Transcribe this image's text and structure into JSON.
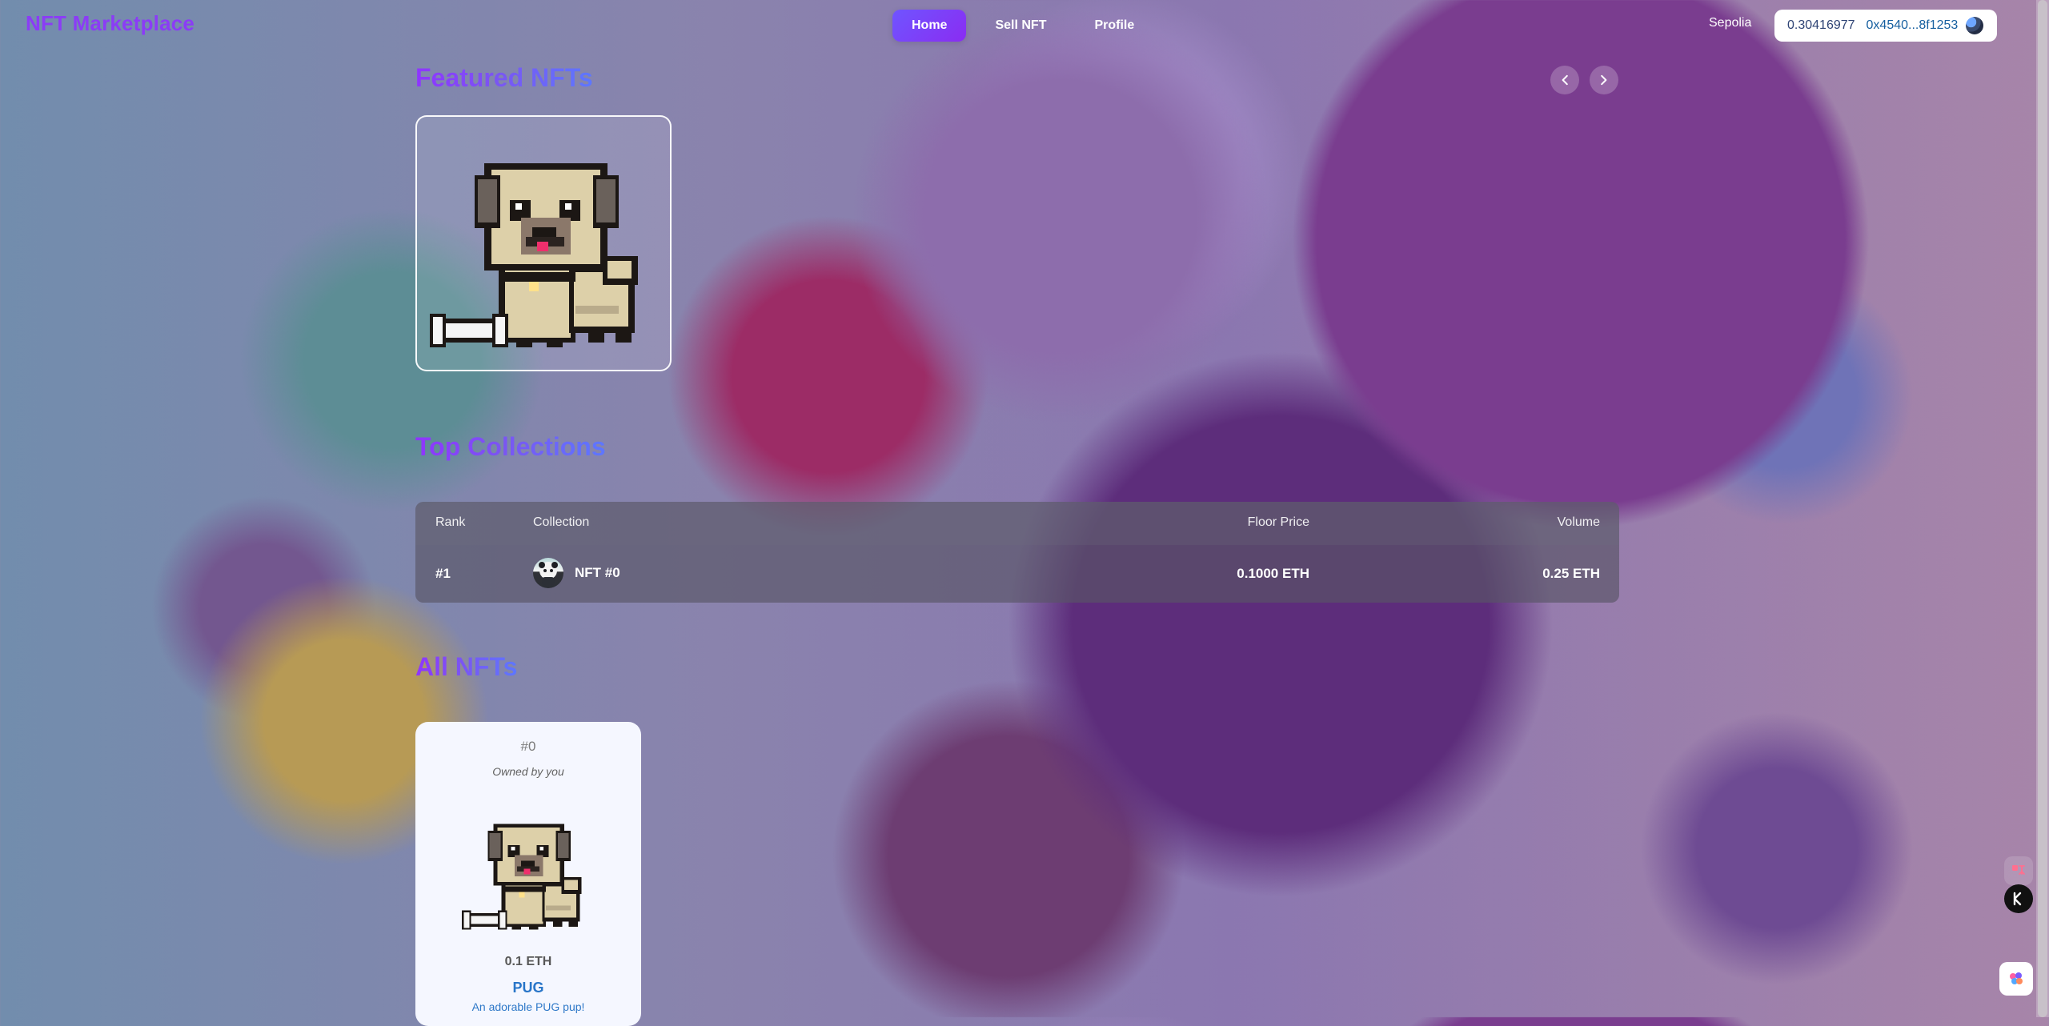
{
  "app": {
    "brand": "NFT Marketplace",
    "nav": [
      {
        "label": "Home",
        "active": true
      },
      {
        "label": "Sell NFT",
        "active": false
      },
      {
        "label": "Profile",
        "active": false
      }
    ],
    "network": "Sepolia",
    "wallet": {
      "balance": "0.30416977",
      "address": "0x4540...8f1253",
      "avatar_icon": "wallet-avatar-icon"
    }
  },
  "sections": {
    "featured_title": "Featured NFTs",
    "collections_title": "Top Collections",
    "all_title": "All NFTs"
  },
  "featured": {
    "icon_left": "chevron-left-icon",
    "icon_right": "chevron-right-icon",
    "item": {
      "image_icon": "pixel-pug-icon"
    }
  },
  "table": {
    "headers": {
      "rank": "Rank",
      "collection": "Collection",
      "floor_price": "Floor Price",
      "volume": "Volume"
    },
    "rows": [
      {
        "rank": "#1",
        "collection": "NFT #0",
        "floor_price": "0.1000 ETH",
        "volume": "0.25 ETH"
      }
    ]
  },
  "nft_card": {
    "id": "#0",
    "owner": "Owned by you",
    "price": "0.1 ETH",
    "name": "PUG",
    "description": "An adorable PUG pup!"
  },
  "tools": {
    "translate_icon": "translate-icon",
    "k_icon": "k-logo-icon",
    "brain_icon": "brain-icon"
  },
  "colors": {
    "brand": "#8b3cf6",
    "accent": "#6f55ff",
    "link": "#2875c8"
  }
}
